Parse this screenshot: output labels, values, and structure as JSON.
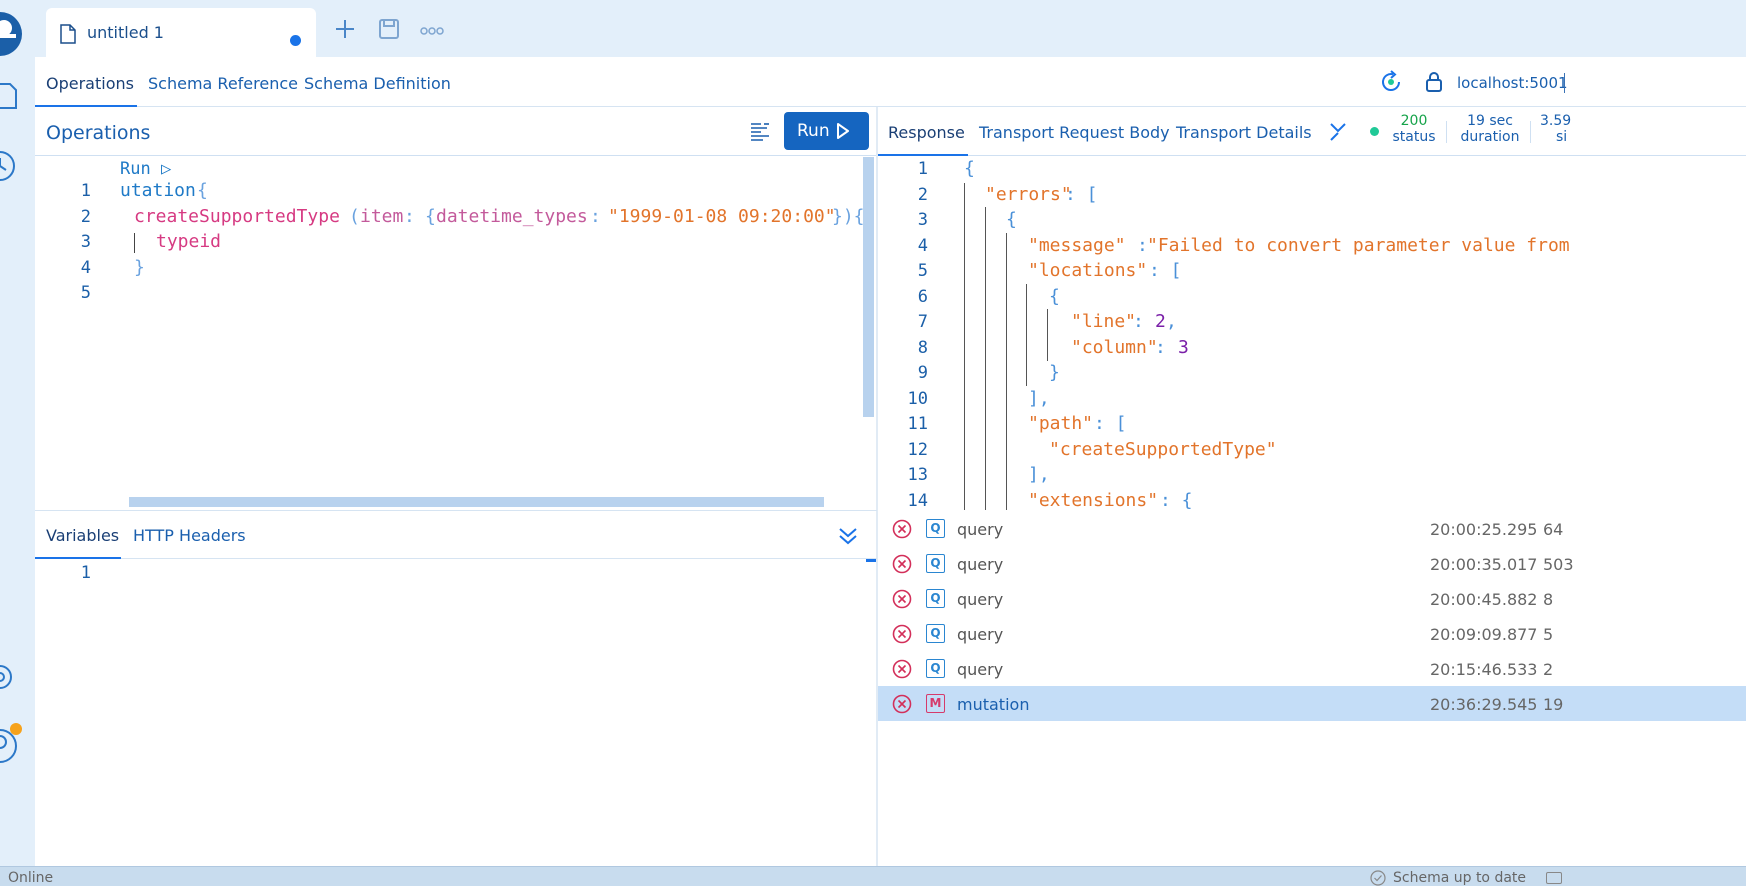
{
  "tabs": {
    "active_title": "untitled 1"
  },
  "nav": {
    "tabs": [
      "Operations",
      "Schema Reference",
      "Schema Definition"
    ],
    "endpoint": "localhost:5001"
  },
  "operations": {
    "title": "Operations",
    "run_label": "Run"
  },
  "editor": {
    "codelens": "Run ▷",
    "line_numbers": [
      "1",
      "2",
      "3",
      "4",
      "5"
    ],
    "lines": {
      "l1_kw": "utation",
      "l1_brace": "{",
      "l2_fn": "createSupportedType",
      "l2_open": "(",
      "l2_arg": "item",
      "l2_colon": ":",
      "l2_obj_open": "{",
      "l2_field": "datetime_types",
      "l2_colon2": ":",
      "l2_value": "\"1999-01-08 09:20:00\"",
      "l2_close": "}){",
      "l3_field": "typeid",
      "l4_close": "}"
    }
  },
  "variables": {
    "tabs": [
      "Variables",
      "HTTP Headers"
    ],
    "line_numbers": [
      "1"
    ]
  },
  "response": {
    "tabs": [
      "Response",
      "Transport Request Body",
      "Transport Details"
    ],
    "status_value": "200",
    "status_label": "status",
    "duration_value": "19 sec",
    "duration_label": "duration",
    "size_value": "3.59",
    "size_label": "si",
    "line_numbers": [
      "1",
      "2",
      "3",
      "4",
      "5",
      "6",
      "7",
      "8",
      "9",
      "10",
      "11",
      "12",
      "13",
      "14"
    ],
    "lines": {
      "l1": "{",
      "l2_key": "\"errors\"",
      "l2_rest": ": [",
      "l3": "{",
      "l4_key": "\"message\"",
      "l4_colon": ": ",
      "l4_val": "\"Failed to convert parameter value from",
      "l5_key": "\"locations\"",
      "l5_rest": ": [",
      "l6": "{",
      "l7_key": "\"line\"",
      "l7_colon": ": ",
      "l7_val": "2",
      "l7_comma": ",",
      "l8_key": "\"column\"",
      "l8_colon": ": ",
      "l8_val": "3",
      "l9": "}",
      "l10": "],",
      "l11_key": "\"path\"",
      "l11_rest": ": [",
      "l12": "\"createSupportedType\"",
      "l13": "],",
      "l14_key": "\"extensions\"",
      "l14_rest": ": {"
    }
  },
  "history": [
    {
      "type": "Q",
      "name": "query",
      "time": "20:00:25.295",
      "size": "64",
      "selected": false
    },
    {
      "type": "Q",
      "name": "query",
      "time": "20:00:35.017",
      "size": "503",
      "selected": false
    },
    {
      "type": "Q",
      "name": "query",
      "time": "20:00:45.882",
      "size": "8",
      "selected": false
    },
    {
      "type": "Q",
      "name": "query",
      "time": "20:09:09.877",
      "size": "5",
      "selected": false
    },
    {
      "type": "Q",
      "name": "query",
      "time": "20:15:46.533",
      "size": "2",
      "selected": false
    },
    {
      "type": "M",
      "name": "mutation",
      "time": "20:36:29.545",
      "size": "19",
      "selected": true
    }
  ],
  "footer": {
    "left": "Online",
    "right": "Schema up to date"
  },
  "colors": {
    "accent": "#1a73e8",
    "run_button": "#1565c0",
    "error": "#d32f5a",
    "query_badge": "#2a86d1",
    "mutation_badge": "#d63a6b",
    "status_ok": "#20c997"
  },
  "icons": [
    "logo-icon",
    "document-icon",
    "history-icon",
    "settings-icon",
    "account-icon",
    "file-icon",
    "plus-icon",
    "save-icon",
    "more-icon",
    "refresh-icon",
    "lock-icon",
    "format-icon",
    "play-icon",
    "collapse-icon",
    "chevron-double-down-icon",
    "error-icon"
  ]
}
